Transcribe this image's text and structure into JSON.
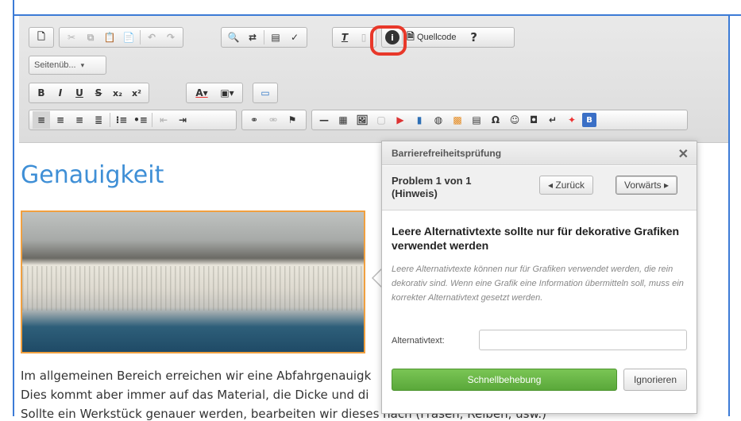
{
  "toolbar": {
    "source_label": "Quellcode",
    "help_label": "?",
    "format_combo": "Seitenüb...",
    "combo_arrow": "▾"
  },
  "content": {
    "heading": "Genauigkeit",
    "lines": [
      "Im allgemeinen Bereich erreichen wir eine Abfahrgenauigk",
      "Dies kommt aber immer auf das Material, die Dicke und di",
      "Sollte ein Werkstück genauer werden, bearbeiten wir dieses nach (Fräsen, Reiben, usw.)"
    ]
  },
  "dialog": {
    "title": "Barrierefreiheitsprüfung",
    "close": "✕",
    "problem": "Problem 1 von 1 (Hinweis)",
    "back_label": "◂ Zurück",
    "forward_label": "Vorwärts ▸",
    "issue_title": "Leere Alternativtexte sollte nur für dekorative Grafiken verwendet werden",
    "issue_desc": "Leere Alternativtexte können nur für Grafiken verwendet werden, die rein dekorativ sind. Wenn eine Grafik eine Information übermitteln soll, muss ein korrekter Alternativtext gesetzt werden.",
    "alt_label": "Alternativtext:",
    "alt_value": "",
    "quickfix_label": "Schnellbehebung",
    "ignore_label": "Ignorieren"
  },
  "colors": {
    "accent_blue": "#3c7bd6",
    "heading_blue": "#3f8fd6",
    "highlight_red": "#e8382a",
    "quickfix_green": "#6cb648",
    "image_border": "#f0a040"
  }
}
